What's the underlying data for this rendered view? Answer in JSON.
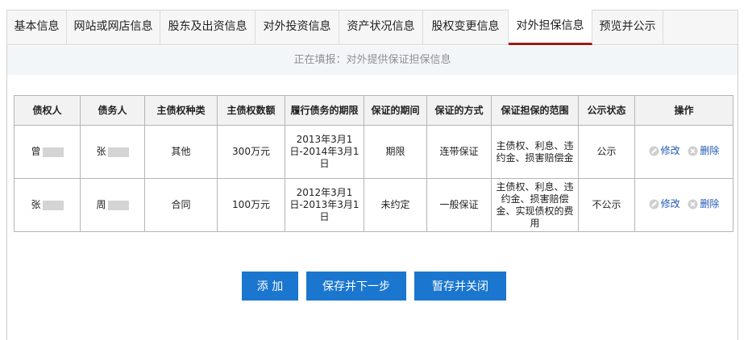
{
  "tabs": [
    {
      "label": "基本信息",
      "active": false
    },
    {
      "label": "网站或网店信息",
      "active": false
    },
    {
      "label": "股东及出资信息",
      "active": false
    },
    {
      "label": "对外投资信息",
      "active": false
    },
    {
      "label": "资产状况信息",
      "active": false
    },
    {
      "label": "股权变更信息",
      "active": false
    },
    {
      "label": "对外担保信息",
      "active": true
    },
    {
      "label": "预览并公示",
      "active": false
    }
  ],
  "notice": "正在填报：对外提供保证担保信息",
  "table": {
    "headers": [
      "债权人",
      "债务人",
      "主债权种类",
      "主债权数额",
      "履行债务的期限",
      "保证的期间",
      "保证的方式",
      "保证担保的范围",
      "公示状态",
      "操作"
    ],
    "rows": [
      {
        "creditor": "曾",
        "debtor": "张",
        "type": "其他",
        "amount": "300万元",
        "term": "2013年3月1日-2014年3月1日",
        "period": "期限",
        "method": "连带保证",
        "scope": "主债权、利息、违约金、损害赔偿金",
        "status": "公示"
      },
      {
        "creditor": "张",
        "debtor": "周",
        "type": "合同",
        "amount": "100万元",
        "term": "2012年3月1日-2013年3月1日",
        "period": "未约定",
        "method": "一般保证",
        "scope": "主债权、利息、违约金、损害赔偿金、实现债权的费用",
        "status": "不公示"
      }
    ],
    "edit_label": "修改",
    "delete_label": "删除"
  },
  "buttons": {
    "add": "添 加",
    "save_next": "保存并下一步",
    "save_close": "暂存并关闭"
  },
  "colors": {
    "accent": "#9b1b14",
    "button": "#1a76cf",
    "link": "#1f57b5"
  },
  "icons": {
    "edit": "pencil-icon",
    "delete": "close-circle-icon"
  }
}
